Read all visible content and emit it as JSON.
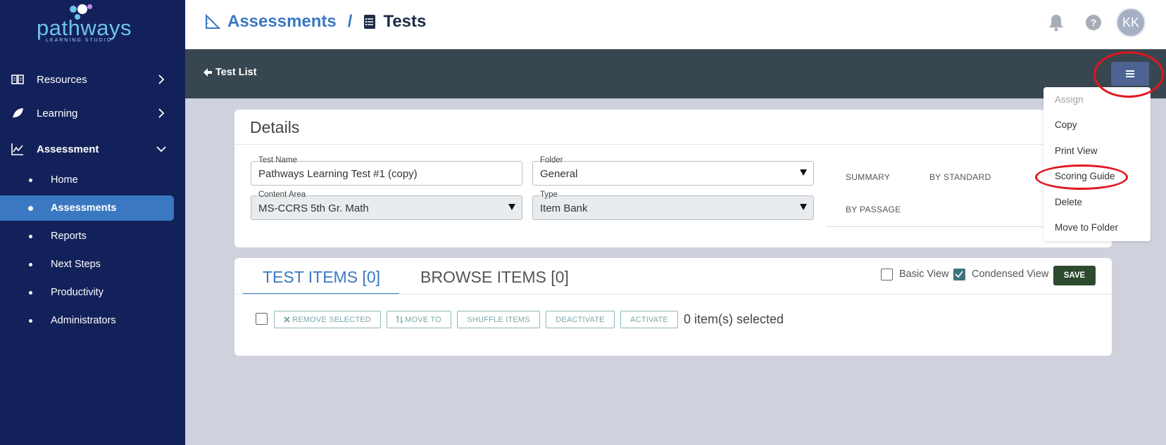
{
  "app": {
    "logo_text": "pathways",
    "logo_subtext": "LEARNING STUDIO"
  },
  "sidebar": {
    "items": [
      {
        "label": "Resources",
        "icon": "book-icon"
      },
      {
        "label": "Learning",
        "icon": "leaf-icon"
      },
      {
        "label": "Assessment",
        "icon": "chart-line-icon"
      }
    ],
    "subitems": [
      {
        "label": "Home"
      },
      {
        "label": "Assessments"
      },
      {
        "label": "Reports"
      },
      {
        "label": "Next Steps"
      },
      {
        "label": "Productivity"
      },
      {
        "label": "Administrators"
      }
    ]
  },
  "header": {
    "crumb_parent": "Assessments",
    "crumb_separator": "/",
    "crumb_current": "Tests",
    "avatar_initials": "KK"
  },
  "actionbar": {
    "back_label": "Test List"
  },
  "details": {
    "title": "Details",
    "fields": {
      "test_name": {
        "label": "Test Name",
        "value": "Pathways Learning Test #1 (copy)"
      },
      "folder": {
        "label": "Folder",
        "value": "General"
      },
      "content_area": {
        "label": "Content Area",
        "value": "MS-CCRS 5th Gr. Math"
      },
      "type": {
        "label": "Type",
        "value": "Item Bank"
      }
    },
    "side_tabs": [
      "SUMMARY",
      "BY STANDARD",
      "BY PASSAGE"
    ]
  },
  "menu": {
    "items": [
      "Assign",
      "Copy",
      "Print View",
      "Scoring Guide",
      "Delete",
      "Move to Folder"
    ]
  },
  "items_panel": {
    "tabs": [
      "TEST ITEMS [0]",
      "BROWSE ITEMS [0]"
    ],
    "basic_view_label": "Basic View",
    "condensed_view_label": "Condensed View",
    "save_label": "SAVE",
    "tools": [
      "REMOVE SELECTED",
      "MOVE TO",
      "SHUFFLE ITEMS",
      "DEACTIVATE",
      "ACTIVATE"
    ],
    "selected_count": "0 item(s) selected"
  },
  "colors": {
    "sidebar_bg": "#13215a",
    "active_item": "#3a78c2",
    "actionbar": "#38474f",
    "save_button": "#2c4a2e",
    "annotation": "#e0161e"
  }
}
